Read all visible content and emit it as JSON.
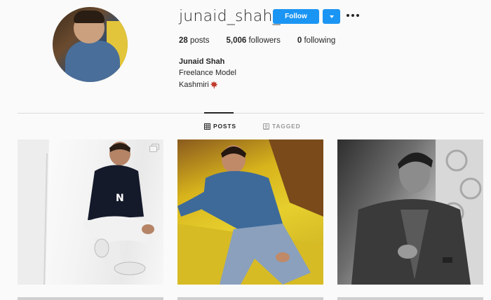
{
  "profile": {
    "username": "junaid_shah_rk",
    "follow_label": "Follow",
    "stats": {
      "posts_count": "28",
      "posts_label": "posts",
      "followers_count": "5,006",
      "followers_label": "followers",
      "following_count": "0",
      "following_label": "following"
    },
    "full_name": "Junaid Shah",
    "bio_line1": "Freelance Model",
    "bio_line2": "Kashmiri"
  },
  "tabs": [
    {
      "label": "POSTS",
      "icon": "grid-icon",
      "active": true
    },
    {
      "label": "TAGGED",
      "icon": "tag-icon",
      "active": false
    }
  ],
  "colors": {
    "accent": "#1b95f3",
    "leaf": "#c0392b"
  },
  "icons": {
    "more": "more-options-icon",
    "dropdown": "chevron-down-icon",
    "leaf": "maple-leaf-icon",
    "multi": "multiple-images-icon"
  }
}
